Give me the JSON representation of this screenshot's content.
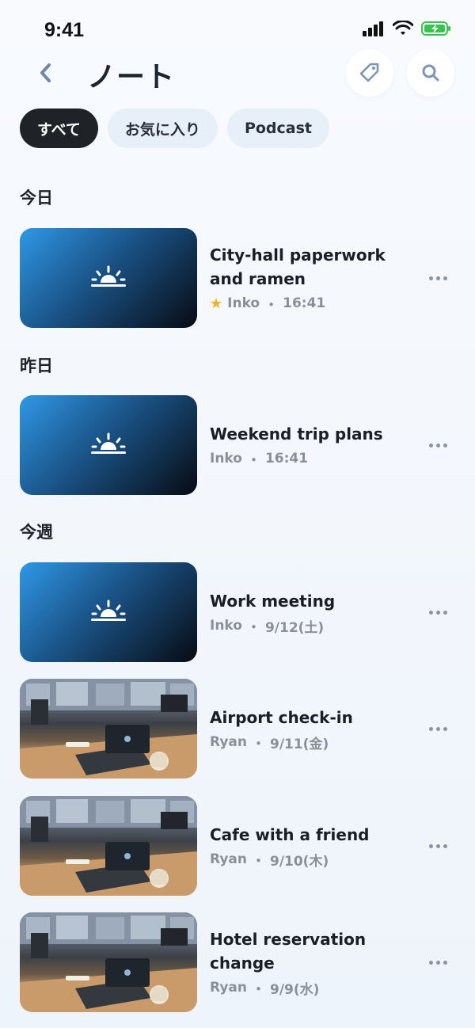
{
  "status_bar": {
    "time": "9:41"
  },
  "header": {
    "title": "ノート"
  },
  "filters": [
    "すべて",
    "お気に入り",
    "Podcast"
  ],
  "sections": {
    "today": "今日",
    "yesterday": "昨日",
    "this_week": "今週"
  },
  "notes": [
    {
      "title": "City-hall paperwork and ramen",
      "author": "Inko",
      "time": "16:41",
      "favorite": true,
      "thumbnail": "sunrise-icon"
    },
    {
      "title": "Weekend trip plans",
      "author": "Inko",
      "time": "16:41",
      "favorite": false,
      "thumbnail": "sunrise-icon"
    },
    {
      "title": "Work meeting",
      "author": "Inko",
      "time": "9/12(土)",
      "favorite": false,
      "thumbnail": "sunrise-icon"
    },
    {
      "title": "Airport check-in",
      "author": "Ryan",
      "time": "9/11(金)",
      "favorite": false,
      "thumbnail": "office-photo"
    },
    {
      "title": "Cafe with a friend",
      "author": "Ryan",
      "time": "9/10(木)",
      "favorite": false,
      "thumbnail": "office-photo"
    },
    {
      "title": "Hotel reservation change",
      "author": "Ryan",
      "time": "9/9(水)",
      "favorite": false,
      "thumbnail": "office-photo"
    }
  ],
  "separator": "・",
  "colors": {
    "accent_dark": "#1f2227",
    "chip_bg": "#e7eff9",
    "star": "#f2b01e",
    "meta": "#8a909a"
  }
}
